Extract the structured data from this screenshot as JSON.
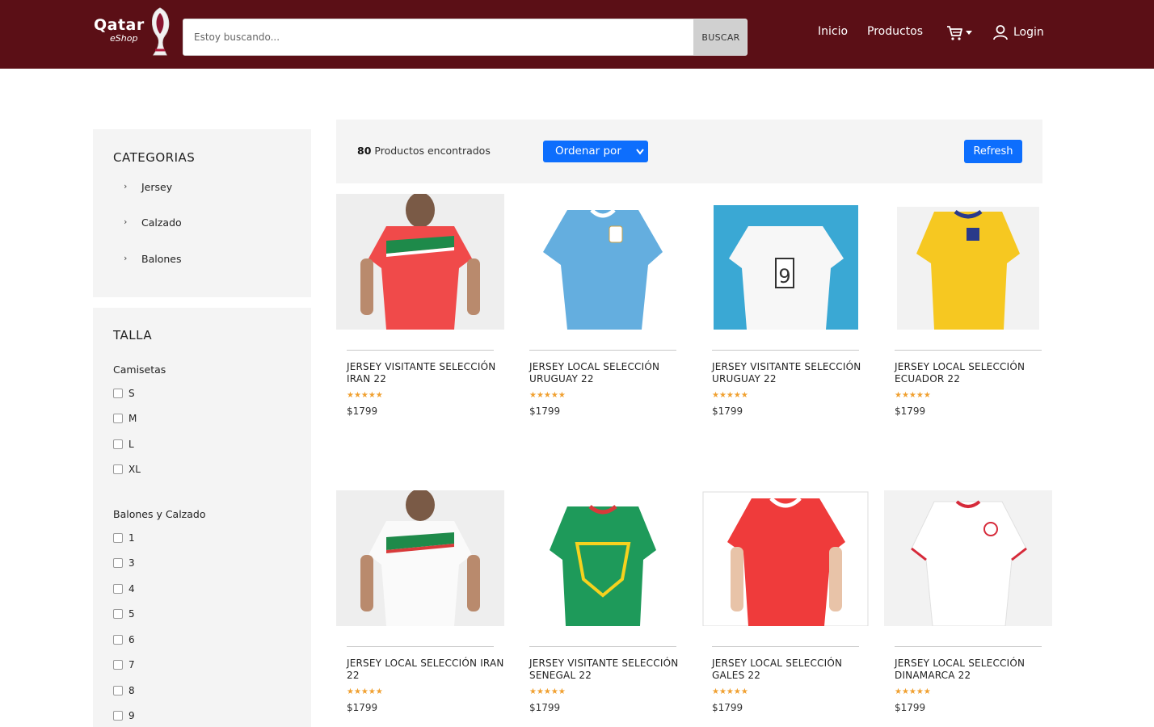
{
  "header": {
    "logo_text": "Qatar",
    "logo_sub": "eShop",
    "search_placeholder": "Estoy buscando...",
    "search_button": "BUSCAR",
    "nav_inicio": "Inicio",
    "nav_productos": "Productos",
    "nav_login": "Login"
  },
  "sidebar": {
    "categories_title": "CATEGORIAS",
    "categories": [
      {
        "label": "Jersey"
      },
      {
        "label": "Calzado"
      },
      {
        "label": "Balones"
      }
    ],
    "talla_title": "TALLA",
    "camisetas_title": "Camisetas",
    "camisetas_sizes": [
      "S",
      "M",
      "L",
      "XL"
    ],
    "balones_title": "Balones y Calzado",
    "balones_sizes": [
      "1",
      "3",
      "4",
      "5",
      "6",
      "7",
      "8",
      "9"
    ]
  },
  "toolbar": {
    "count": "80",
    "count_label": "Productos encontrados",
    "sort_label": "Ordenar por",
    "refresh_label": "Refresh"
  },
  "colors": {
    "header_bg": "#5b0f16",
    "accent": "#0d6efd",
    "star": "#f0a030"
  },
  "products": [
    {
      "title": "JERSEY VISITANTE SELECCIÓN IRAN 22",
      "stars": "★★★★★",
      "price": "$1799"
    },
    {
      "title": "JERSEY LOCAL SELECCIÓN URUGUAY 22",
      "stars": "★★★★★",
      "price": "$1799"
    },
    {
      "title": "JERSEY VISITANTE SELECCIÓN URUGUAY 22",
      "stars": "★★★★★",
      "price": "$1799"
    },
    {
      "title": "JERSEY LOCAL SELECCIÓN ECUADOR 22",
      "stars": "★★★★★",
      "price": "$1799"
    },
    {
      "title": "JERSEY LOCAL SELECCIÓN IRAN 22",
      "stars": "★★★★★",
      "price": "$1799"
    },
    {
      "title": "JERSEY VISITANTE SELECCIÓN SENEGAL 22",
      "stars": "★★★★★",
      "price": "$1799"
    },
    {
      "title": "JERSEY LOCAL SELECCIÓN GALES 22",
      "stars": "★★★★★",
      "price": "$1799"
    },
    {
      "title": "JERSEY LOCAL SELECCIÓN DINAMARCA 22",
      "stars": "★★★★★",
      "price": "$1799"
    }
  ]
}
